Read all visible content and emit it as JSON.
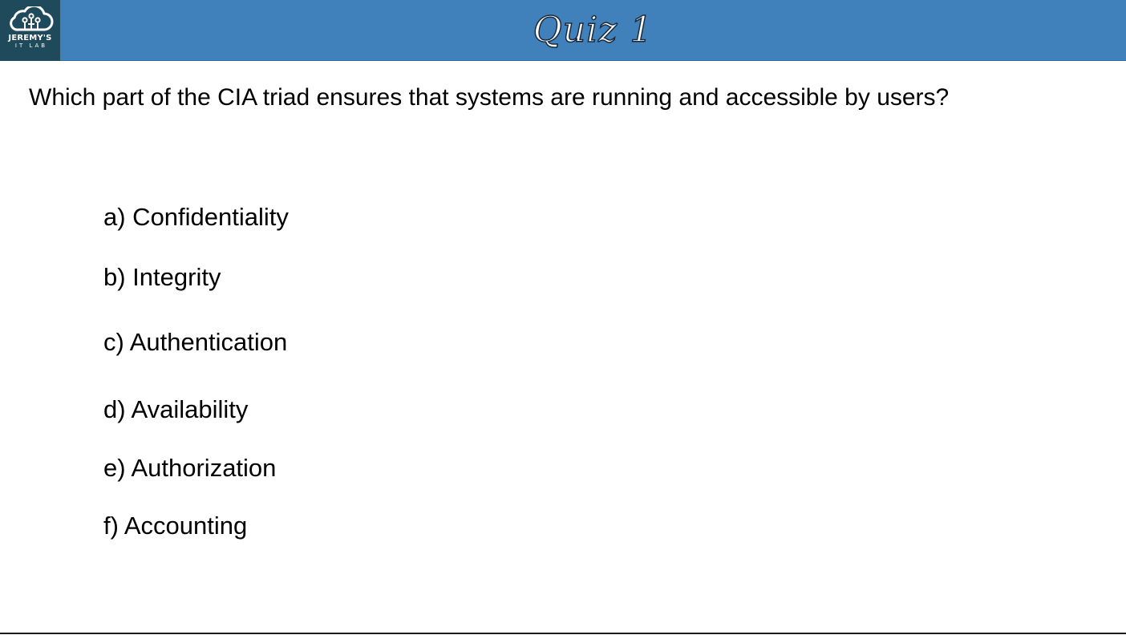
{
  "logo": {
    "line1": "JEREMY'S",
    "line2": "IT LAB"
  },
  "header": {
    "title": "Quiz 1",
    "background_color": "#4080bb"
  },
  "question": "Which part of the CIA triad ensures that systems are running and accessible by users?",
  "options": [
    {
      "text": "a) Confidentiality"
    },
    {
      "text": "b) Integrity"
    },
    {
      "text": "c) Authentication"
    },
    {
      "text": "d) Availability"
    },
    {
      "text": "e) Authorization"
    },
    {
      "text": "f) Accounting"
    }
  ]
}
